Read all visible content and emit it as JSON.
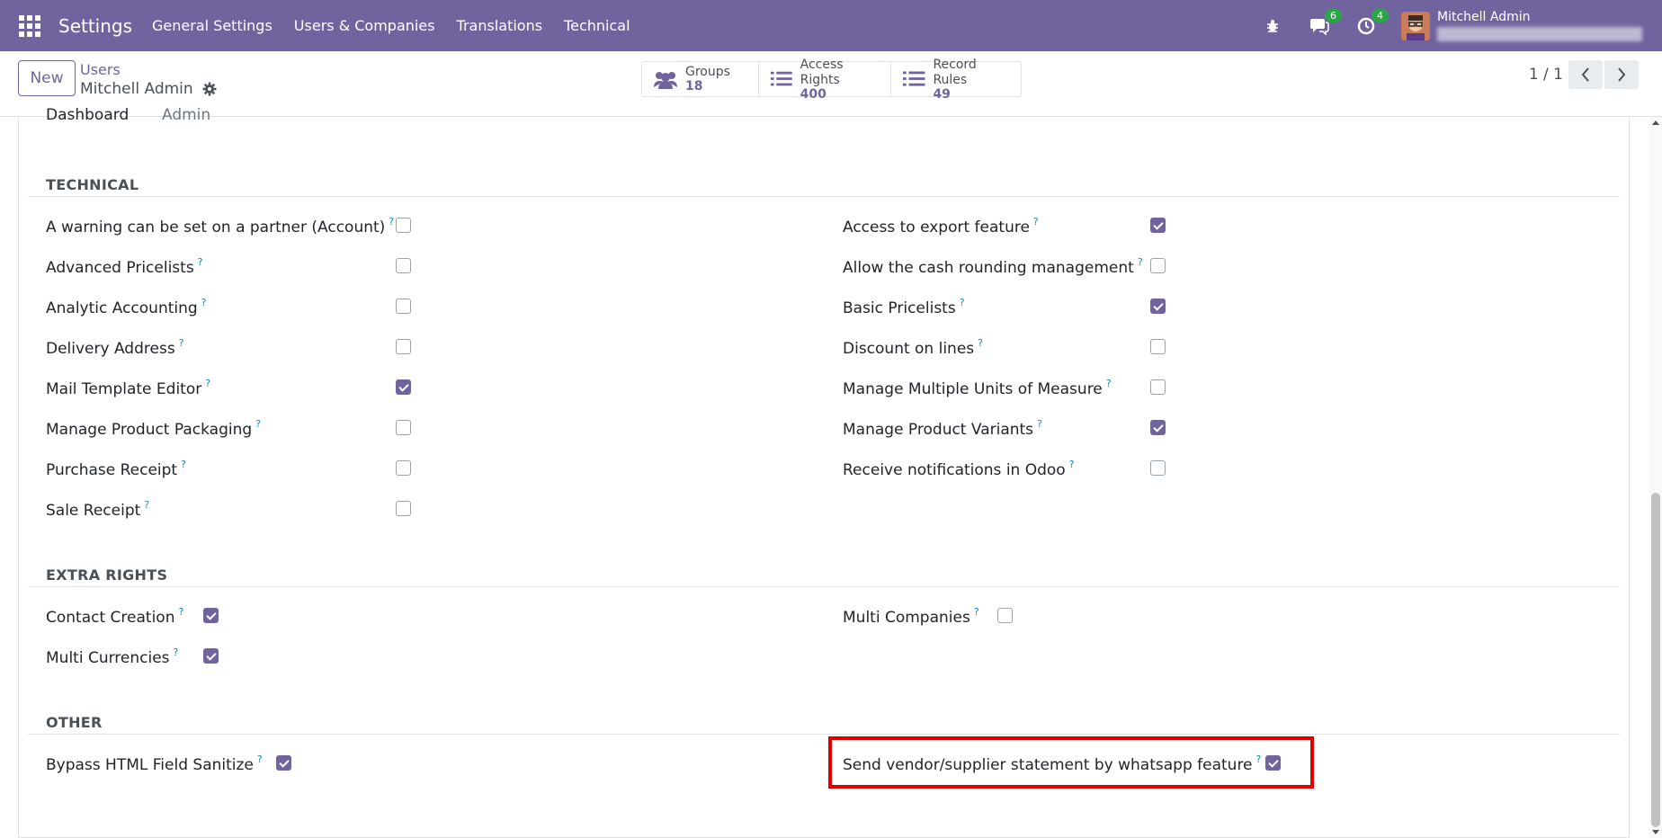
{
  "navbar": {
    "brand": "Settings",
    "menu": [
      "General Settings",
      "Users & Companies",
      "Translations",
      "Technical"
    ],
    "chat_badge": "6",
    "activity_badge": "4",
    "user_name": "Mitchell Admin"
  },
  "control": {
    "new_label": "New",
    "breadcrumb": "Users",
    "record_name": "Mitchell Admin",
    "smart_buttons": [
      {
        "label": "Groups",
        "value": "18",
        "icon": "users-icon"
      },
      {
        "label": "Access Rights",
        "value": "400",
        "icon": "list-icon"
      },
      {
        "label": "Record Rules",
        "value": "49",
        "icon": "list-icon"
      }
    ],
    "pager": "1 / 1"
  },
  "partial": {
    "label": "Dashboard",
    "value": "Admin"
  },
  "sections": {
    "technical": {
      "title": "TECHNICAL",
      "left": [
        {
          "label": "A warning can be set on a partner (Account)",
          "checked": false
        },
        {
          "label": "Advanced Pricelists",
          "checked": false
        },
        {
          "label": "Analytic Accounting",
          "checked": false
        },
        {
          "label": "Delivery Address",
          "checked": false
        },
        {
          "label": "Mail Template Editor",
          "checked": true
        },
        {
          "label": "Manage Product Packaging",
          "checked": false
        },
        {
          "label": "Purchase Receipt",
          "checked": false
        },
        {
          "label": "Sale Receipt",
          "checked": false
        }
      ],
      "right": [
        {
          "label": "Access to export feature",
          "checked": true
        },
        {
          "label": "Allow the cash rounding management",
          "checked": false
        },
        {
          "label": "Basic Pricelists",
          "checked": true
        },
        {
          "label": "Discount on lines",
          "checked": false
        },
        {
          "label": "Manage Multiple Units of Measure",
          "checked": false
        },
        {
          "label": "Manage Product Variants",
          "checked": true
        },
        {
          "label": "Receive notifications in Odoo",
          "checked": false
        }
      ]
    },
    "extra": {
      "title": "EXTRA RIGHTS",
      "left": [
        {
          "label": "Contact Creation",
          "checked": true
        },
        {
          "label": "Multi Currencies",
          "checked": true
        }
      ],
      "right": [
        {
          "label": "Multi Companies",
          "checked": false
        }
      ]
    },
    "other": {
      "title": "OTHER",
      "left": [
        {
          "label": "Bypass HTML Field Sanitize",
          "checked": true
        }
      ],
      "right": [
        {
          "label": "Send vendor/supplier statement by whatsapp feature",
          "checked": true
        }
      ]
    }
  },
  "help_mark": "?",
  "colors": {
    "brand": "#71639e",
    "highlight": "#e00000",
    "badge": "#28a745"
  }
}
